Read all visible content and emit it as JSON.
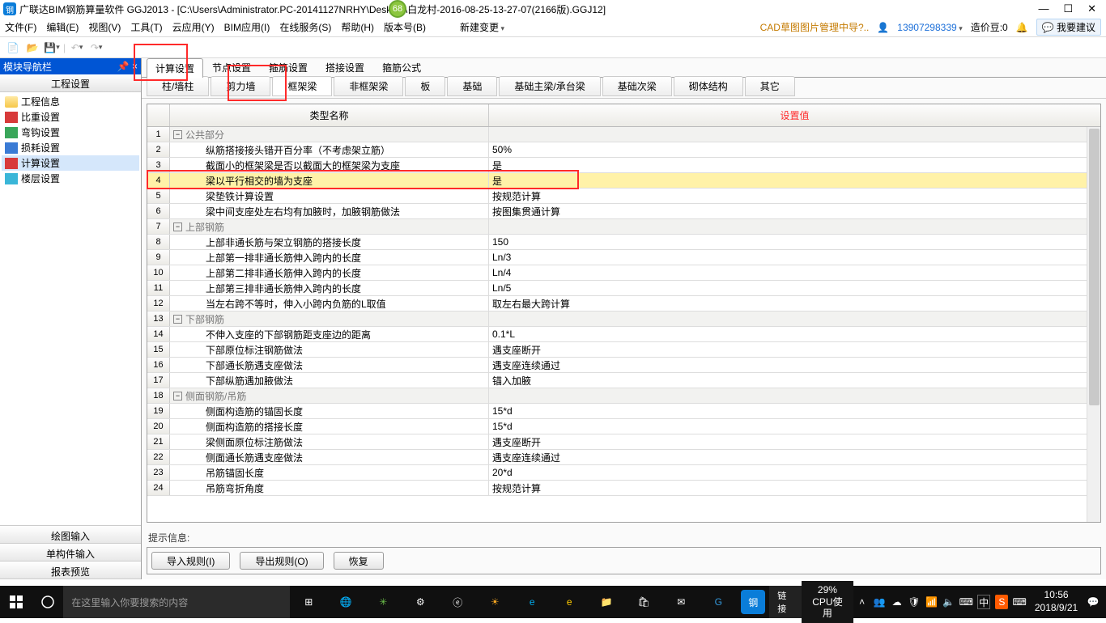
{
  "title_bar": {
    "app_icon": "钢",
    "title": "广联达BIM钢筋算量软件 GGJ2013 - [C:\\Users\\Administrator.PC-20141127NRHY\\Desktop\\白龙村-2016-08-25-13-27-07(2166版).GGJ12]",
    "badge": "68"
  },
  "menu": {
    "items": [
      "文件(F)",
      "编辑(E)",
      "视图(V)",
      "工具(T)",
      "云应用(Y)",
      "BIM应用(I)",
      "在线服务(S)",
      "帮助(H)",
      "版本号(B)"
    ],
    "new_change": "新建变更",
    "cad": "CAD草图图片管理中导?..",
    "user": "13907298339",
    "beans_label": "造价豆:0",
    "feedback": "我要建议"
  },
  "sidebar": {
    "title": "模块导航栏",
    "header": "工程设置",
    "items": [
      {
        "label": "工程信息",
        "ic": "ic-folder"
      },
      {
        "label": "比重设置",
        "ic": "ic-red"
      },
      {
        "label": "弯钩设置",
        "ic": "ic-green"
      },
      {
        "label": "损耗设置",
        "ic": "ic-blue"
      },
      {
        "label": "计算设置",
        "ic": "ic-red",
        "sel": true
      },
      {
        "label": "楼层设置",
        "ic": "ic-cyan"
      }
    ],
    "bottom": [
      "绘图输入",
      "单构件输入",
      "报表预览"
    ]
  },
  "tabs1": [
    "计算设置",
    "节点设置",
    "箍筋设置",
    "搭接设置",
    "箍筋公式"
  ],
  "tabs1_active": 0,
  "tabs2": [
    "柱/墙柱",
    "剪力墙",
    "框架梁",
    "非框架梁",
    "板",
    "基础",
    "基础主梁/承台梁",
    "基础次梁",
    "砌体结构",
    "其它"
  ],
  "tabs2_active": 2,
  "grid": {
    "col1": "类型名称",
    "col2": "设置值",
    "rows": [
      {
        "n": 1,
        "section": true,
        "label": "公共部分"
      },
      {
        "n": 2,
        "label": "纵筋搭接接头错开百分率（不考虑架立筋）",
        "val": "50%"
      },
      {
        "n": 3,
        "label": "截面小的框架梁是否以截面大的框架梁为支座",
        "val": "是"
      },
      {
        "n": 4,
        "label": "梁以平行相交的墙为支座",
        "val": "是",
        "hl": true
      },
      {
        "n": 5,
        "label": "梁垫铁计算设置",
        "val": "按规范计算"
      },
      {
        "n": 6,
        "label": "梁中间支座处左右均有加腋时，加腋钢筋做法",
        "val": "按图集贯通计算"
      },
      {
        "n": 7,
        "section": true,
        "label": "上部钢筋"
      },
      {
        "n": 8,
        "label": "上部非通长筋与架立钢筋的搭接长度",
        "val": "150"
      },
      {
        "n": 9,
        "label": "上部第一排非通长筋伸入跨内的长度",
        "val": "Ln/3"
      },
      {
        "n": 10,
        "label": "上部第二排非通长筋伸入跨内的长度",
        "val": "Ln/4"
      },
      {
        "n": 11,
        "label": "上部第三排非通长筋伸入跨内的长度",
        "val": "Ln/5"
      },
      {
        "n": 12,
        "label": "当左右跨不等时，伸入小跨内负筋的L取值",
        "val": "取左右最大跨计算"
      },
      {
        "n": 13,
        "section": true,
        "label": "下部钢筋"
      },
      {
        "n": 14,
        "label": "不伸入支座的下部钢筋距支座边的距离",
        "val": "0.1*L"
      },
      {
        "n": 15,
        "label": "下部原位标注钢筋做法",
        "val": "遇支座断开"
      },
      {
        "n": 16,
        "label": "下部通长筋遇支座做法",
        "val": "遇支座连续通过"
      },
      {
        "n": 17,
        "label": "下部纵筋遇加腋做法",
        "val": "锚入加腋"
      },
      {
        "n": 18,
        "section": true,
        "label": "侧面钢筋/吊筋"
      },
      {
        "n": 19,
        "label": "侧面构造筋的锚固长度",
        "val": "15*d"
      },
      {
        "n": 20,
        "label": "侧面构造筋的搭接长度",
        "val": "15*d"
      },
      {
        "n": 21,
        "label": "梁侧面原位标注筋做法",
        "val": "遇支座断开"
      },
      {
        "n": 22,
        "label": "侧面通长筋遇支座做法",
        "val": "遇支座连续通过"
      },
      {
        "n": 23,
        "label": "吊筋锚固长度",
        "val": "20*d"
      },
      {
        "n": 24,
        "label": "吊筋弯折角度",
        "val": "按规范计算"
      }
    ]
  },
  "hint": "提示信息:",
  "buttons": {
    "import": "导入规则(I)",
    "export": "导出规则(O)",
    "restore": "恢复"
  },
  "taskbar": {
    "search_placeholder": "在这里输入你要搜索的内容",
    "link": "链接",
    "cpu_pct": "29%",
    "cpu_label": "CPU使用",
    "ime": "中",
    "time": "10:56",
    "date": "2018/9/21"
  }
}
